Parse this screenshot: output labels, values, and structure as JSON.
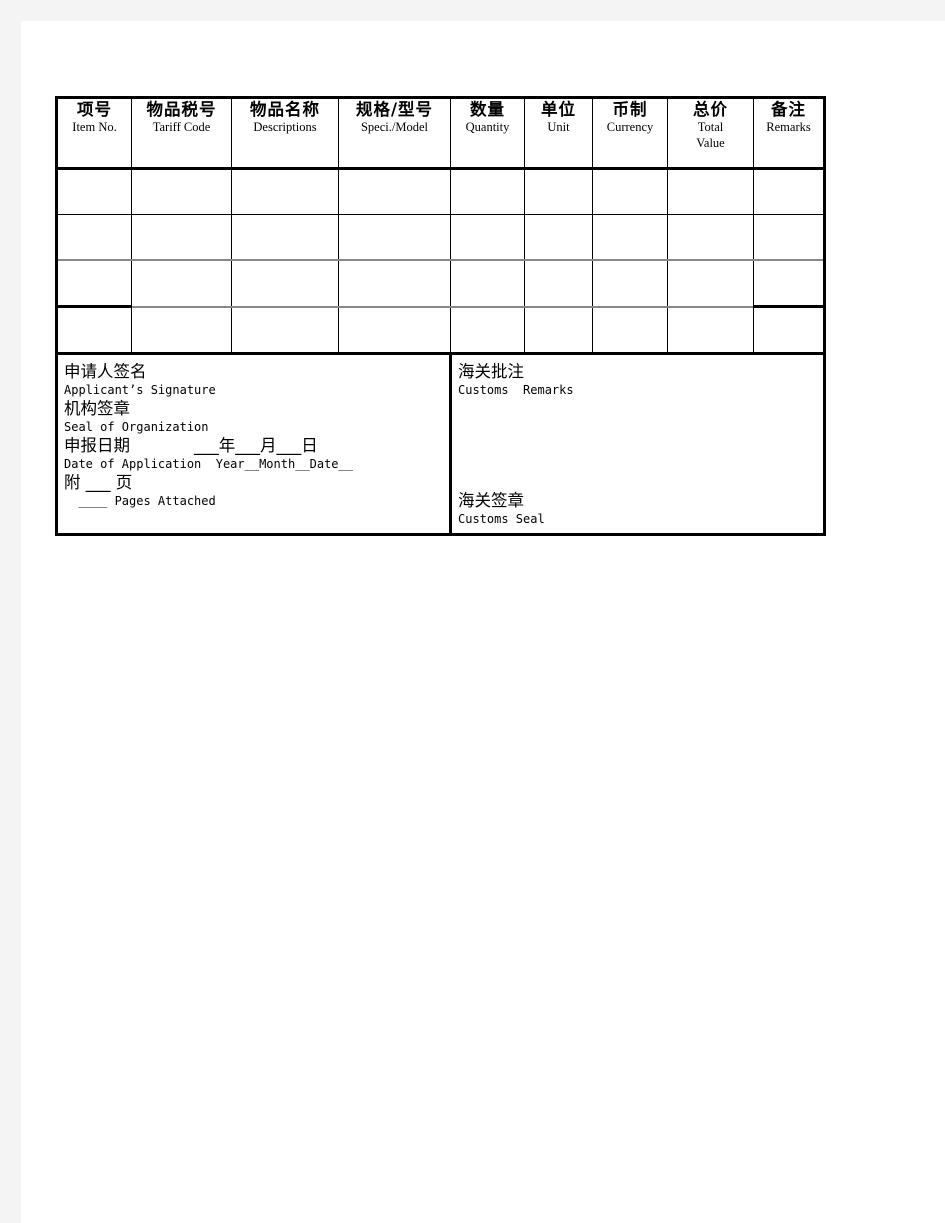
{
  "document": {
    "type": "customs-declaration-form",
    "page_background": "#f4f4f4",
    "sheet_background": "#ffffff"
  },
  "table": {
    "columns": [
      {
        "cn": "项号",
        "en": "Item No.",
        "en2": ""
      },
      {
        "cn": "物品税号",
        "en": "Tariff Code",
        "en2": ""
      },
      {
        "cn": "物品名称",
        "en": "Descriptions",
        "en2": ""
      },
      {
        "cn": "规格/型号",
        "en": "Speci./Model",
        "en2": ""
      },
      {
        "cn": "数量",
        "en": "Quantity",
        "en2": ""
      },
      {
        "cn": "单位",
        "en": "Unit",
        "en2": ""
      },
      {
        "cn": "币制",
        "en": "Currency",
        "en2": ""
      },
      {
        "cn": "总价",
        "en": "Total",
        "en2": "Value"
      },
      {
        "cn": "备注",
        "en": "Remarks",
        "en2": ""
      }
    ],
    "data_rows": [
      [
        "",
        "",
        "",
        "",
        "",
        "",
        "",
        "",
        ""
      ],
      [
        "",
        "",
        "",
        "",
        "",
        "",
        "",
        "",
        ""
      ],
      [
        "",
        "",
        "",
        "",
        "",
        "",
        "",
        "",
        ""
      ],
      [
        "",
        "",
        "",
        "",
        "",
        "",
        "",
        "",
        ""
      ]
    ]
  },
  "footer": {
    "applicant": {
      "signature_cn": "申请人签名",
      "signature_en": "Applicant’s Signature",
      "seal_cn": "机构签章",
      "seal_en": "Seal of Organization",
      "date_cn": "申报日期",
      "date_cn_blanks": "___年___月___日",
      "date_en": "Date of Application  Year__Month__Date__",
      "pages_cn": "附 ___ 页",
      "pages_en": "  ____ Pages Attached"
    },
    "customs": {
      "remarks_cn": "海关批注",
      "remarks_en": "Customs  Remarks",
      "seal_cn": "海关签章",
      "seal_en": "Customs Seal"
    }
  }
}
